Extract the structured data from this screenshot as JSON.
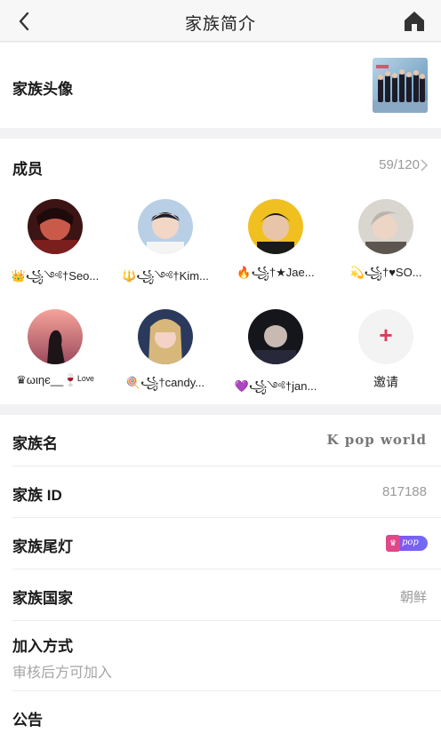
{
  "navbar": {
    "title": "家族简介",
    "back_icon": "chevron-left-icon",
    "home_icon": "home-icon"
  },
  "avatar_row": {
    "label": "家族头像"
  },
  "members": {
    "label": "成员",
    "count": "59/120",
    "list": [
      {
        "name": "👑꧁༺†Seo..."
      },
      {
        "name": "🔱꧁༺†Kim..."
      },
      {
        "name": "🔥꧁†★Jae..."
      },
      {
        "name": "💫꧁†♥SO..."
      },
      {
        "name": "♛ωιηє__🍷ᴸᵒᵛᵉ"
      },
      {
        "name": "🍭꧁†candy..."
      },
      {
        "name": "💜꧁༺†jan..."
      }
    ],
    "invite_label": "邀请"
  },
  "info": {
    "family_name_label": "家族名",
    "family_name_value": "K pop world",
    "family_id_label": "家族 ID",
    "family_id_value": "817188",
    "tail_light_label": "家族尾灯",
    "tail_light_text": "pop",
    "country_label": "家族国家",
    "country_value": "朝鲜",
    "join_label": "加入方式",
    "join_value": "审核后方可加入",
    "notice_label": "公告"
  },
  "colors": {
    "accent": "#e2385c",
    "tail_gradient_start": "#8a4cf2",
    "tail_gradient_end": "#6f6cf5"
  }
}
